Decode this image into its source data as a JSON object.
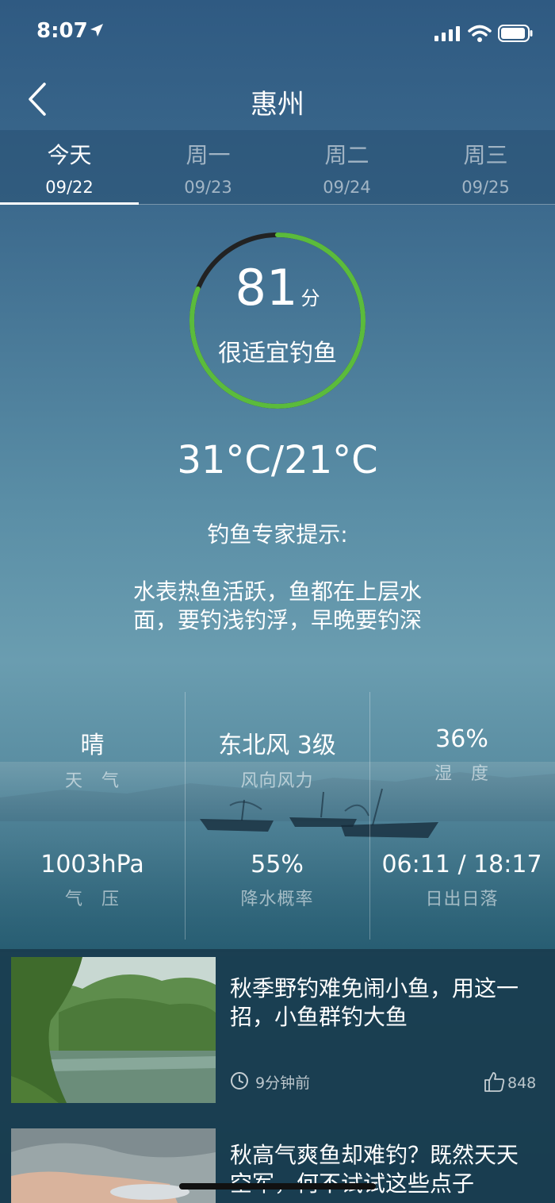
{
  "status": {
    "time": "8:07"
  },
  "header": {
    "title": "惠州"
  },
  "tabs": [
    {
      "day": "今天",
      "date": "09/22",
      "active": true
    },
    {
      "day": "周一",
      "date": "09/23",
      "active": false
    },
    {
      "day": "周二",
      "date": "09/24",
      "active": false
    },
    {
      "day": "周三",
      "date": "09/25",
      "active": false
    }
  ],
  "score": {
    "value": "81",
    "unit": "分",
    "label": "很适宜钓鱼",
    "fraction": 0.81,
    "color": "#5bbb3c"
  },
  "temperature": "31°C/21°C",
  "tip": {
    "title": "钓鱼专家提示:",
    "body": "水表热鱼活跃，鱼都在上层水面，要钓浅钓浮，早晚要钓深"
  },
  "stats": [
    {
      "value": "晴",
      "label": "天　气"
    },
    {
      "value": "东北风 3级",
      "label": "风向风力"
    },
    {
      "value": "36%",
      "label": "湿　度"
    },
    {
      "value": "1003hPa",
      "label": "气　压"
    },
    {
      "value": "55%",
      "label": "降水概率"
    },
    {
      "value": "06:11 / 18:17",
      "label": "日出日落"
    }
  ],
  "news": [
    {
      "title": "秋季野钓难免闹小鱼，用这一招，小鱼群钓大鱼",
      "time": "9分钟前",
      "likes": "848"
    },
    {
      "title": "秋高气爽鱼却难钓？既然天天空军，何不试试这些点子",
      "time": "",
      "likes": ""
    }
  ],
  "icons": [
    "location-arrow-icon",
    "signal-icon",
    "wifi-icon",
    "battery-icon",
    "back-chevron-icon",
    "clock-icon",
    "thumbs-up-icon"
  ]
}
